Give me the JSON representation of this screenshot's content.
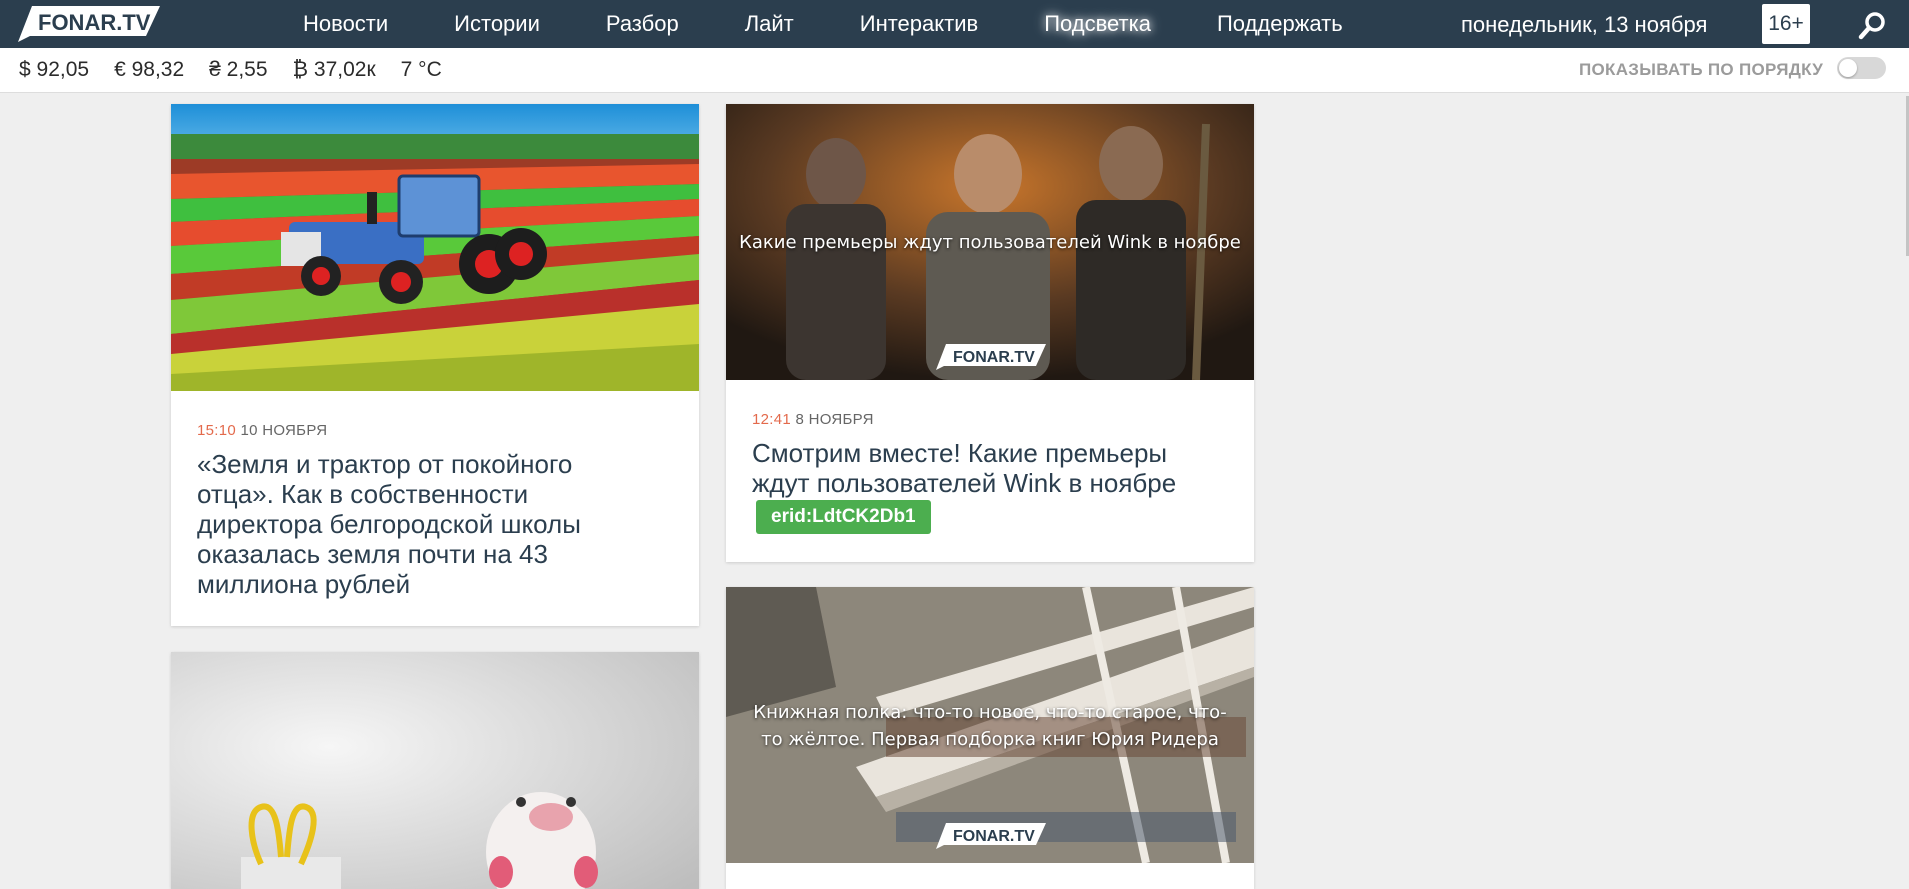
{
  "header": {
    "logo_text": "FONAR.TV",
    "nav": [
      "Новости",
      "Истории",
      "Разбор",
      "Лайт",
      "Интерактив",
      "Подсветка",
      "Поддержать"
    ],
    "date": "понедельник, 13 ноября",
    "age_rating": "16+",
    "search_icon": "search-icon"
  },
  "rates": [
    "$ 92,05",
    "€ 98,32",
    "₴ 2,55",
    "₿ 37,02к",
    "7 °C"
  ],
  "order_toggle": {
    "label": "ПОКАЗЫВАТЬ ПО ПОРЯДКУ",
    "state": "off"
  },
  "cards": [
    {
      "time": "15:10",
      "date": "10 НОЯБРЯ",
      "title": "«Земля и трактор от покойного отца». Как в собственности директора белгородской школы оказалась земля почти на 43 миллиона рублей"
    },
    {
      "time": "12:41",
      "date": "8 НОЯБРЯ",
      "title": "Смотрим вместе! Какие премьеры ждут пользователей Wink в ноябре",
      "erid": "erid:LdtCK2Db1",
      "image_caption": "Какие премьеры ждут пользователей Wink в ноябре",
      "watermark": "FONAR.TV"
    },
    {
      "image_caption": "Книжная полка: что-то новое, что-то старое, что-то жёлтое. Первая подборка книг Юрия Ридера",
      "watermark": "FONAR.TV"
    }
  ],
  "colors": {
    "header_bg": "#2b3e4e",
    "time_accent": "#e36a4c",
    "erid_green": "#4cae4f",
    "title": "#2b3e4e"
  }
}
